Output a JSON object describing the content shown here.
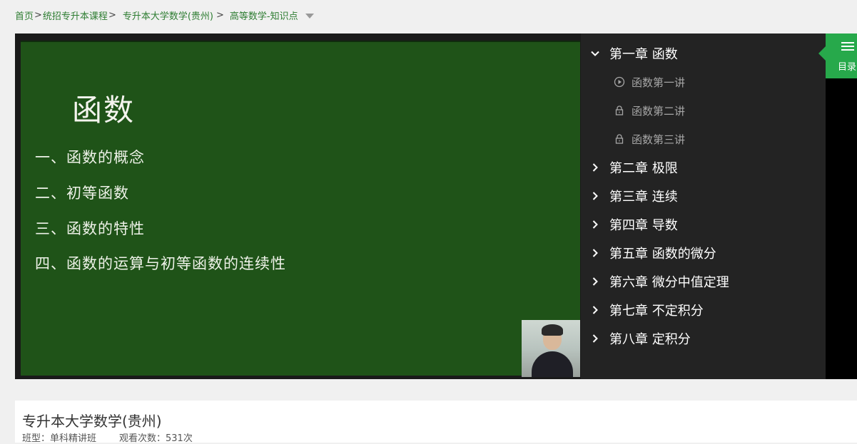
{
  "breadcrumb": {
    "home": "首页",
    "sep": ">",
    "category": "统招专升本课程",
    "course": "专升本大学数学(贵州)",
    "current": "高等数学-知识点"
  },
  "slide": {
    "title": "函数",
    "lines": [
      "一、函数的概念",
      "二、初等函数",
      "三、函数的特性",
      "四、函数的运算与初等函数的连续性"
    ]
  },
  "toc": {
    "chapters": [
      {
        "label": "第一章 函数",
        "expanded": true,
        "lessons": [
          {
            "label": "函数第一讲",
            "icon": "play-circle-icon"
          },
          {
            "label": "函数第二讲",
            "icon": "lock-icon"
          },
          {
            "label": "函数第三讲",
            "icon": "lock-icon"
          }
        ]
      },
      {
        "label": "第二章 极限",
        "expanded": false
      },
      {
        "label": "第三章 连续",
        "expanded": false
      },
      {
        "label": "第四章 导数",
        "expanded": false
      },
      {
        "label": "第五章 函数的微分",
        "expanded": false
      },
      {
        "label": "第六章 微分中值定理",
        "expanded": false
      },
      {
        "label": "第七章 不定积分",
        "expanded": false
      },
      {
        "label": "第八章 定积分",
        "expanded": false
      }
    ]
  },
  "side_tab": {
    "label": "目录"
  },
  "info": {
    "title": "专升本大学数学(贵州)",
    "class_type": "班型：单科精讲班",
    "views": "观看次数：531次"
  },
  "colors": {
    "accent": "#27a94b",
    "link": "#2e7d32",
    "board": "#1f5318"
  }
}
